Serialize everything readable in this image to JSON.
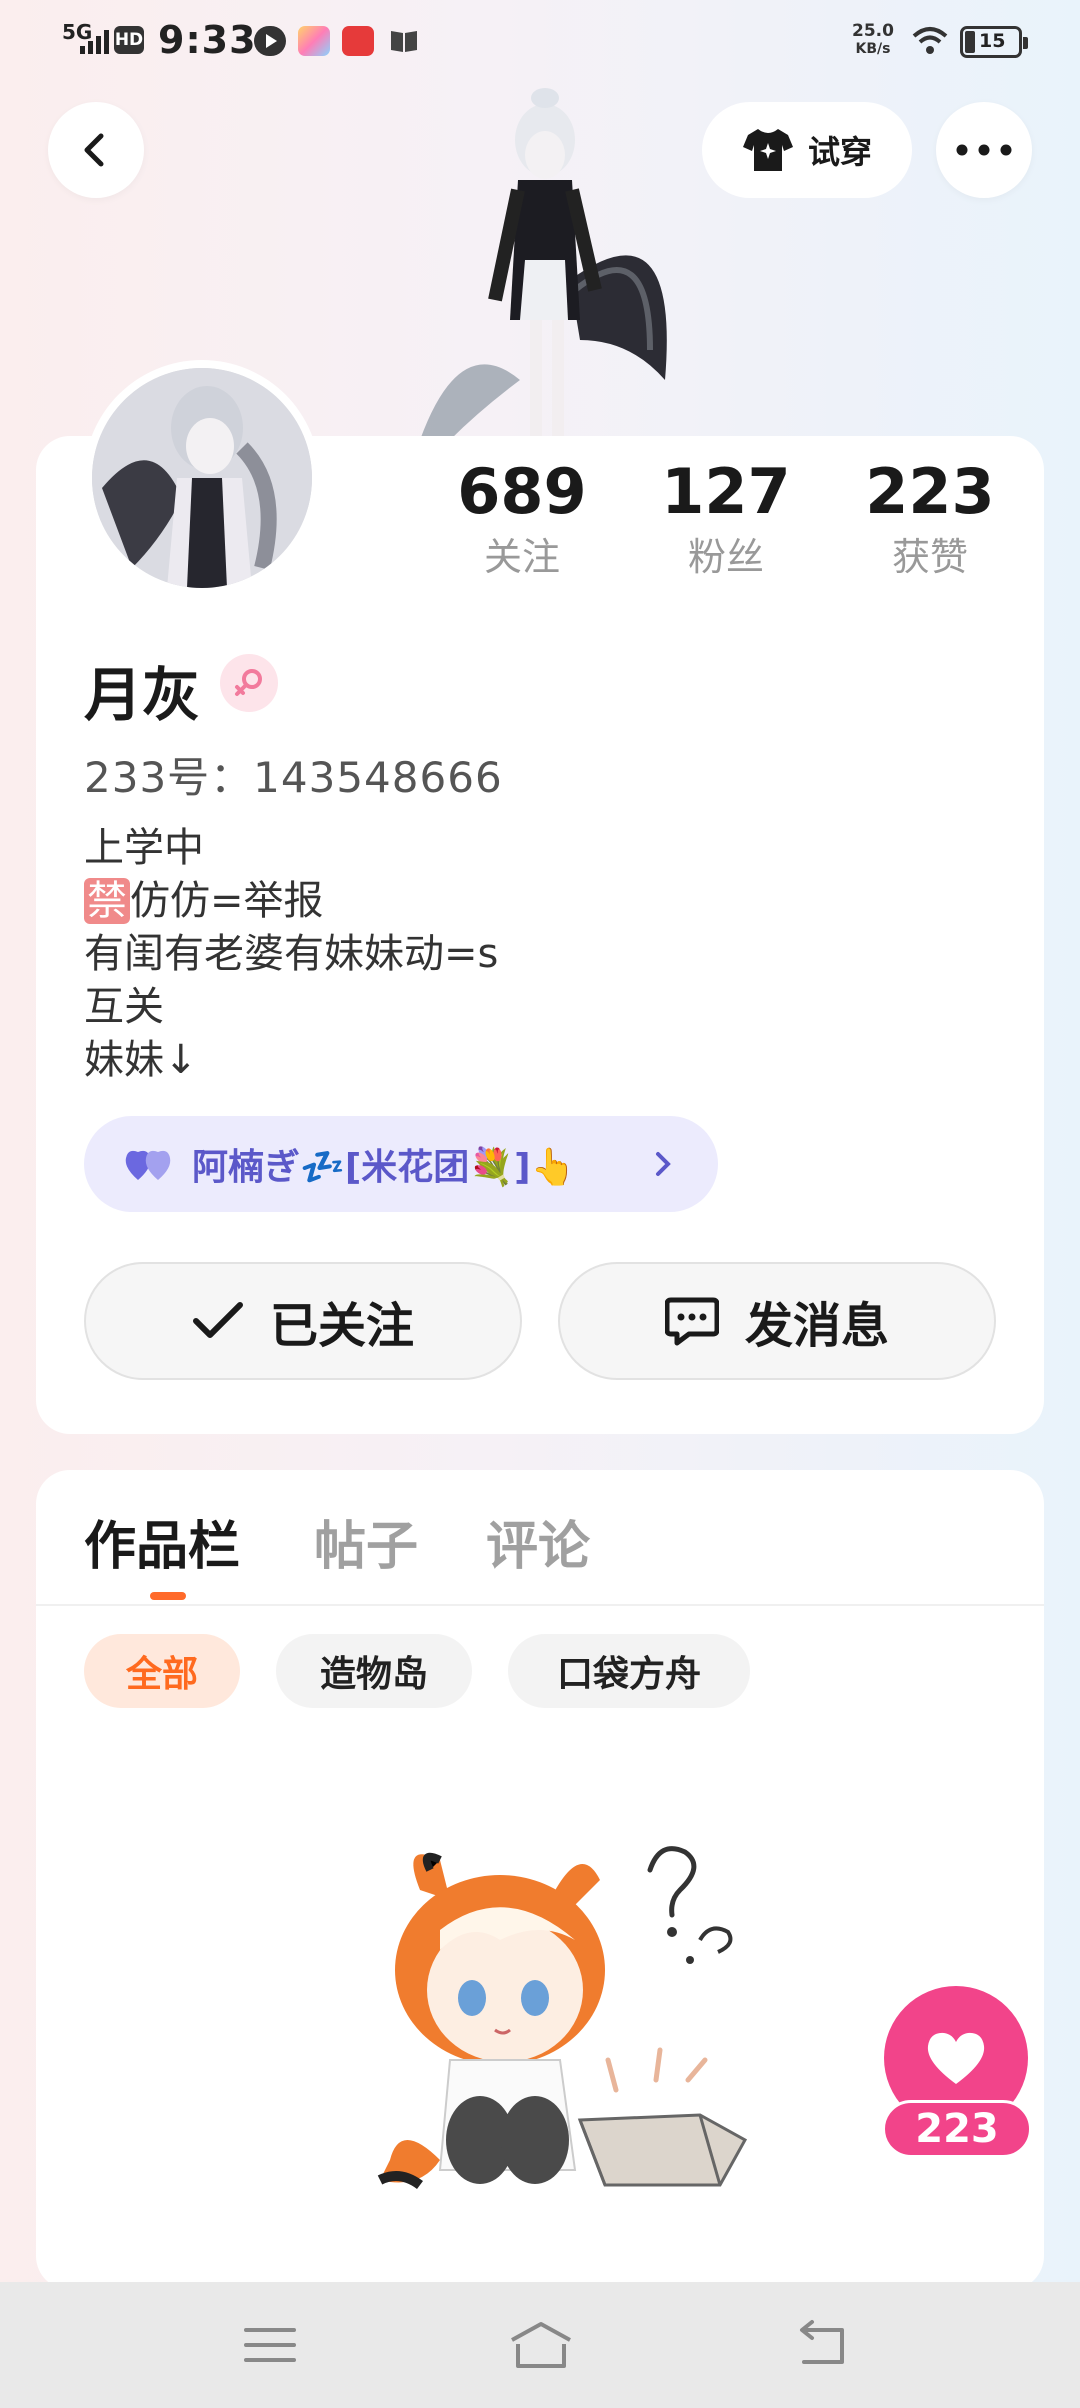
{
  "status_bar": {
    "network": "5G",
    "hd": "HD",
    "time": "9:33",
    "speed_value": "25.0",
    "speed_unit": "KB/s",
    "battery": "15"
  },
  "header": {
    "tryon_label": "试穿"
  },
  "profile": {
    "name": "月灰",
    "uid": "233号：143548666",
    "stats": [
      {
        "value": "689",
        "label": "关注"
      },
      {
        "value": "127",
        "label": "粉丝"
      },
      {
        "value": "223",
        "label": "获赞"
      }
    ],
    "bio": {
      "line1": "上学中",
      "ban_char": "禁",
      "line2_rest": "仿仿=举报",
      "line3": "有闺有老婆有妹妹动=s",
      "line4": "互关",
      "line5": "妹妹↓"
    },
    "relation_pill": "阿楠ぎ💤[米花团💐]👆",
    "follow_label": "已关注",
    "message_label": "发消息"
  },
  "tabs": [
    "作品栏",
    "帖子",
    "评论"
  ],
  "filters": [
    "全部",
    "造物岛",
    "口袋方舟"
  ],
  "like_count": "223",
  "colors": {
    "accent": "#ff6a2a",
    "like": "#f2448a",
    "pill_bg": "#ecebfd",
    "pill_text": "#5b58c9"
  }
}
